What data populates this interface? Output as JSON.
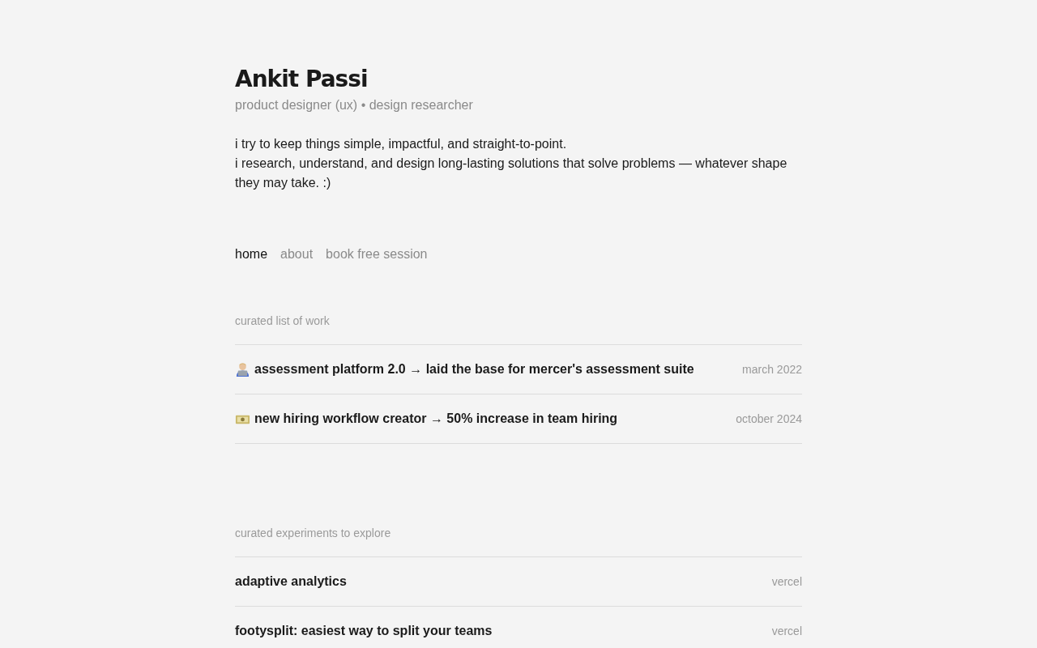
{
  "name": "Ankit Passi",
  "tagline": "product designer (ux) • design researcher",
  "intro": [
    "i try to keep things simple, impactful, and straight-to-point.",
    "i research, understand, and design long-lasting solutions that solve problems — whatever shape they may take. :)"
  ],
  "nav": [
    {
      "label": "home",
      "selected": true
    },
    {
      "label": "about",
      "selected": false
    },
    {
      "label": "book free session",
      "selected": false
    }
  ],
  "sections": [
    {
      "heading": "curated list of work",
      "items": [
        {
          "title": "assessment platform 2.0 → laid the base for mercer's assessment suite",
          "meta": "march 2022"
        },
        {
          "title": "new hiring workflow creator → 50% increase in team hiring",
          "meta": "october 2024"
        }
      ]
    },
    {
      "heading": "curated experiments to explore",
      "items": [
        {
          "title": "adaptive analytics",
          "meta": "vercel"
        },
        {
          "title": "footysplit: easiest way to split your teams",
          "meta": "vercel"
        }
      ]
    }
  ]
}
